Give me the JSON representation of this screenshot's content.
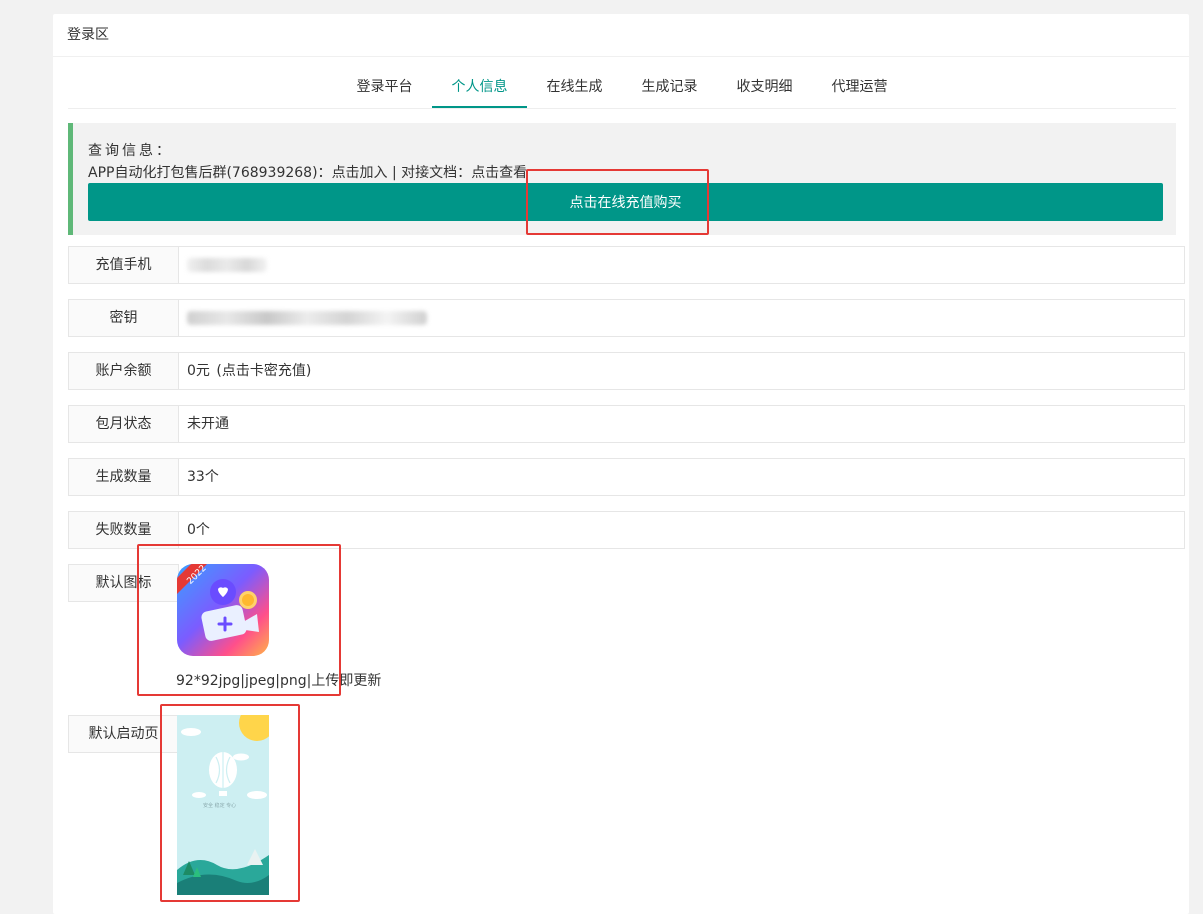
{
  "panel": {
    "title": "登录区"
  },
  "tabs": [
    {
      "label": "登录平台"
    },
    {
      "label": "个人信息",
      "active": true
    },
    {
      "label": "在线生成"
    },
    {
      "label": "生成记录"
    },
    {
      "label": "收支明细"
    },
    {
      "label": "代理运营"
    }
  ],
  "notice": {
    "title": "查询信息：",
    "line_prefix": "APP自动化打包售后群(768939268)：",
    "join_link": "点击加入",
    "separator": " | 对接文档：",
    "doc_link": "点击查看",
    "buy_button": "点击在线充值购买"
  },
  "info": {
    "phone_label": "充值手机",
    "key_label": "密钥",
    "balance_label": "账户余额",
    "balance_value": "0元",
    "balance_link": "(点击卡密充值)",
    "monthly_label": "包月状态",
    "monthly_value": "未开通",
    "generated_label": "生成数量",
    "generated_value": "33个",
    "failed_label": "失败数量",
    "failed_value": "0个",
    "icon_label": "默认图标",
    "icon_hint": "92*92jpg|jpeg|png|上传即更新",
    "icon_badge": "2022",
    "splash_label": "默认启动页",
    "splash_tagline": "安全 稳定 专心"
  },
  "colors": {
    "accent": "#009688",
    "notice_border": "#5fb878",
    "annotation": "#e53935"
  }
}
